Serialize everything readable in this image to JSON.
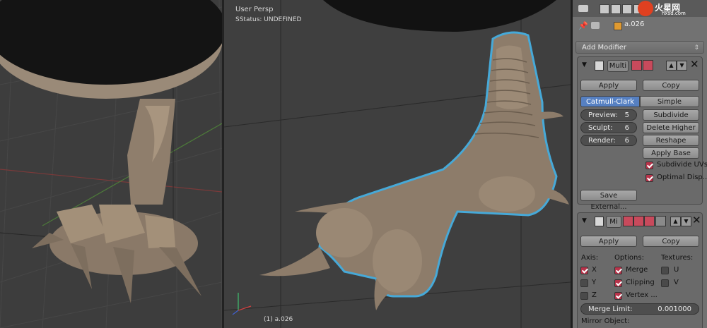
{
  "viewport_left": {},
  "viewport_right": {
    "view_name": "User Persp",
    "status": "SStatus: UNDEFINED",
    "object_label": "(1) a.026"
  },
  "watermark": {
    "text": "hxsd.com",
    "cn": "火星网"
  },
  "panel": {
    "object_name": "a.026",
    "add_modifier": "Add Modifier",
    "multires": {
      "name": "Multi",
      "apply": "Apply",
      "copy": "Copy",
      "tab_catmull": "Catmull-Clark",
      "tab_simple": "Simple",
      "preview_label": "Preview:",
      "preview_value": "5",
      "sculpt_label": "Sculpt:",
      "sculpt_value": "6",
      "render_label": "Render:",
      "render_value": "6",
      "subdivide": "Subdivide",
      "delete_higher": "Delete Higher",
      "reshape": "Reshape",
      "apply_base": "Apply Base",
      "subdivide_uvs": "Subdivide UVs",
      "optimal_display": "Optimal Disp...",
      "save_external": "Save External..."
    },
    "mirror": {
      "name": "Mi",
      "apply": "Apply",
      "copy": "Copy",
      "axis_label": "Axis:",
      "options_label": "Options:",
      "textures_label": "Textures:",
      "axis_x": "X",
      "axis_y": "Y",
      "axis_z": "Z",
      "merge": "Merge",
      "clipping": "Clipping",
      "vertex": "Vertex ...",
      "tex_u": "U",
      "tex_v": "V",
      "merge_limit_label": "Merge Limit:",
      "merge_limit_value": "0.001000",
      "mirror_object": "Mirror Object:"
    }
  }
}
